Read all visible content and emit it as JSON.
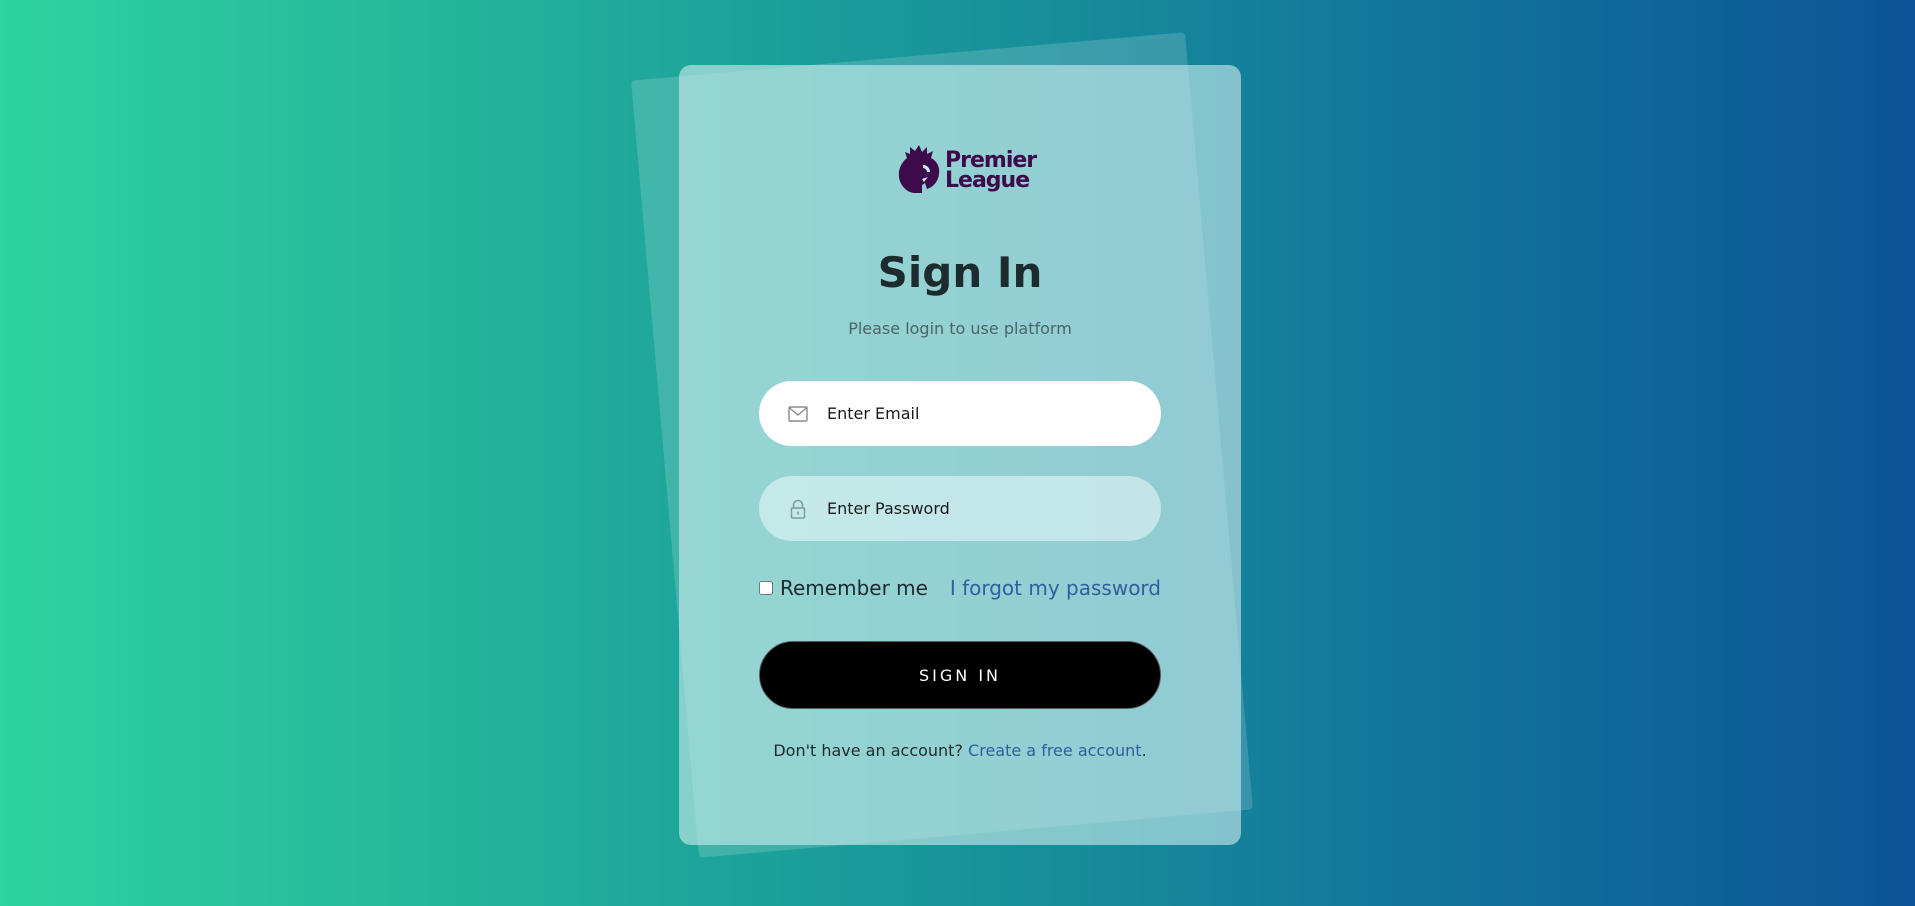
{
  "logo": {
    "name": "Premier League",
    "line1": "Premier",
    "line2": "League",
    "color": "#3d0a4b"
  },
  "title": "Sign In",
  "subtitle": "Please login to use platform",
  "email": {
    "placeholder": "Enter Email",
    "value": "",
    "icon": "mail-icon"
  },
  "password": {
    "placeholder": "Enter Password",
    "value": "",
    "icon": "lock-icon"
  },
  "remember": {
    "label": "Remember me",
    "checked": false
  },
  "forgot_link": "I forgot my password",
  "signin_button": "SIGN IN",
  "footer": {
    "prompt": "Don't have an account?",
    "link": "Create a free account",
    "suffix": "."
  },
  "colors": {
    "background_start": "#2ed39e",
    "background_end": "#0c5498",
    "link": "#2f5f9e",
    "button": "#000000"
  }
}
